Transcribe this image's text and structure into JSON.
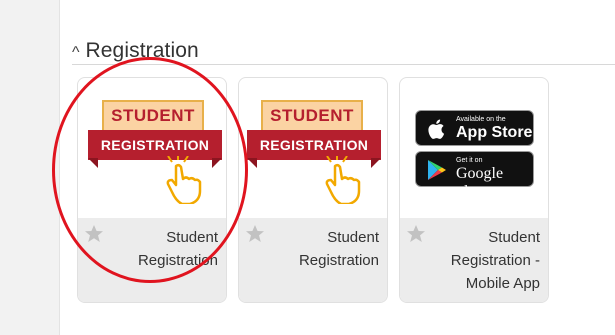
{
  "section": {
    "chevron": "^",
    "title": "Registration"
  },
  "tiles": [
    {
      "badge_top": "STUDENT",
      "badge_bottom": "REGISTRATION",
      "label": "Student Registration"
    },
    {
      "badge_top": "STUDENT",
      "badge_bottom": "REGISTRATION",
      "label": "Student Registration"
    },
    {
      "appstore_small": "Available on the",
      "appstore_big": "App Store",
      "googleplay_small": "Get it on",
      "googleplay_big": "Google play",
      "label": "Student Registration - Mobile App"
    }
  ],
  "colors": {
    "badge_red": "#b51f2e",
    "badge_cream": "#fbd3a3",
    "highlight": "#e0141f",
    "star": "#c2c2c2"
  }
}
